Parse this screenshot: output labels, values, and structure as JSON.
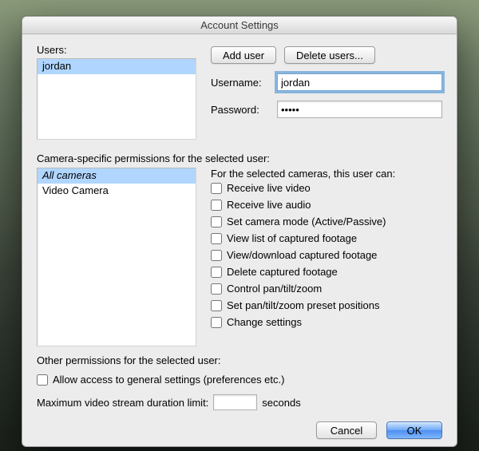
{
  "window": {
    "title": "Account Settings"
  },
  "users": {
    "label": "Users:",
    "items": [
      {
        "name": "jordan",
        "selected": true
      }
    ]
  },
  "buttons": {
    "add_user": "Add user",
    "delete_users": "Delete users...",
    "cancel": "Cancel",
    "ok": "OK"
  },
  "fields": {
    "username_label": "Username:",
    "username_value": "jordan",
    "password_label": "Password:",
    "password_value": "•••••"
  },
  "camera_section": {
    "label": "Camera-specific permissions for the selected user:",
    "cameras": [
      {
        "name": "All cameras",
        "italic": true,
        "selected": true
      },
      {
        "name": "Video Camera",
        "italic": false,
        "selected": false
      }
    ],
    "perm_header": "For the selected cameras, this user can:",
    "perms": [
      "Receive live video",
      "Receive live audio",
      "Set camera mode (Active/Passive)",
      "View list of captured footage",
      "View/download captured footage",
      "Delete captured footage",
      "Control pan/tilt/zoom",
      "Set pan/tilt/zoom preset positions",
      "Change settings"
    ]
  },
  "other": {
    "label": "Other permissions for the selected user:",
    "allow_general": "Allow access to general settings (preferences etc.)",
    "max_label_pre": "Maximum video stream duration limit:",
    "max_value": "",
    "max_label_post": "seconds"
  }
}
